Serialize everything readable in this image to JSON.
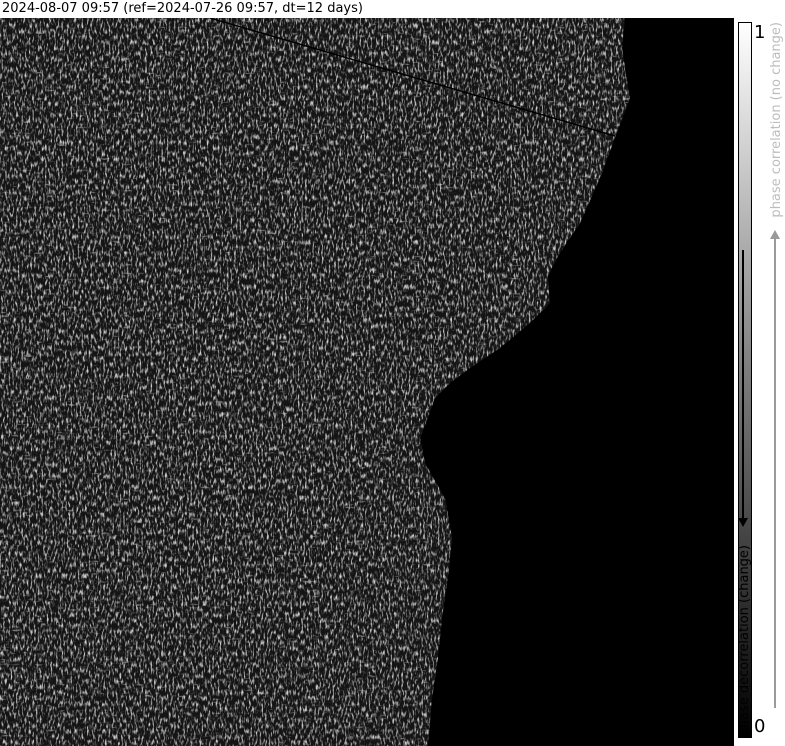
{
  "title": "2024-08-07 09:57 (ref=2024-07-26 09:57, dt=12 days)",
  "colorbar": {
    "max_label": "1",
    "min_label": "0",
    "low_label": "phase decorrelation (change)",
    "high_label": "phase correlation (no change)"
  },
  "image": {
    "description_icon": "sar-coherence-map"
  }
}
